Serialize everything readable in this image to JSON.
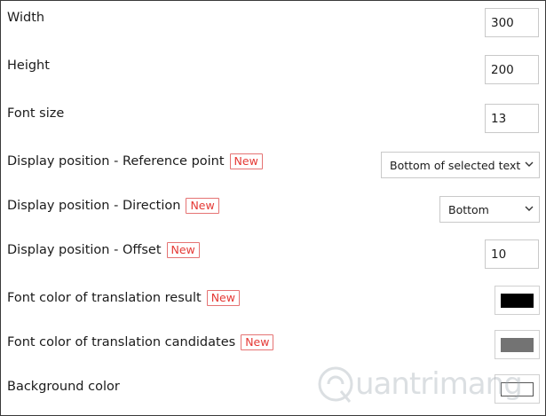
{
  "new_badge": "New",
  "settings": {
    "width": {
      "label": "Width",
      "value": "300"
    },
    "height": {
      "label": "Height",
      "value": "200"
    },
    "font_size": {
      "label": "Font size",
      "value": "13"
    },
    "reference_point": {
      "label": "Display position - Reference point",
      "selected": "Bottom of selected text"
    },
    "direction": {
      "label": "Display position - Direction",
      "selected": "Bottom"
    },
    "offset": {
      "label": "Display position - Offset",
      "value": "10"
    },
    "result_color": {
      "label": "Font color of translation result",
      "color": "#000000"
    },
    "candidates_color": {
      "label": "Font color of translation candidates",
      "color": "#737373"
    },
    "background_color": {
      "label": "Background color",
      "color": "#ffffff"
    }
  },
  "watermark": {
    "text": "uantrimang"
  }
}
